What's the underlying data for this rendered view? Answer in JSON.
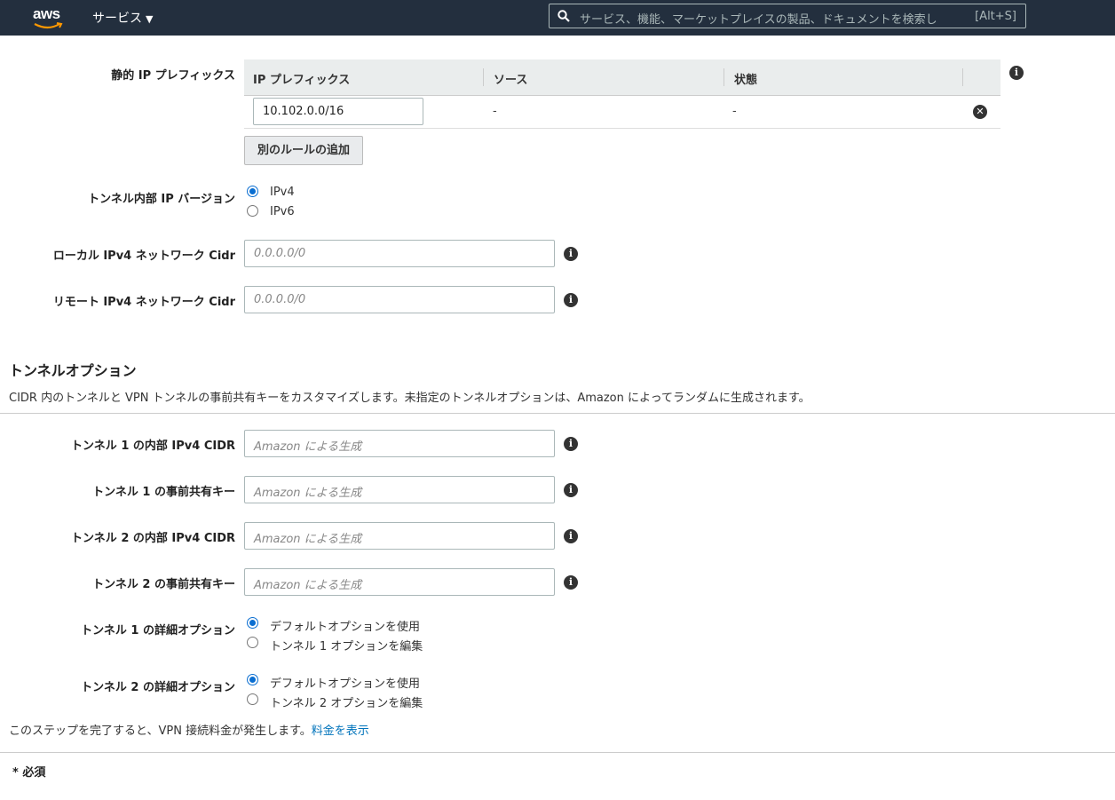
{
  "topbar": {
    "logo_text": "aws",
    "services_label": "サービス",
    "search_placeholder": "サービス、機能、マーケットプレイスの製品、ドキュメントを検索し",
    "search_shortcut": "[Alt+S]"
  },
  "static_ip": {
    "label": "静的 IP プレフィックス",
    "columns": [
      "IP プレフィックス",
      "ソース",
      "状態"
    ],
    "row": {
      "prefix": "10.102.0.0/16",
      "source": "-",
      "state": "-"
    },
    "add_rule_button": "別のルールの追加"
  },
  "tunnel_ip_version": {
    "label": "トンネル内部 IP バージョン",
    "options": [
      "IPv4",
      "IPv6"
    ],
    "selected": "IPv4"
  },
  "local_cidr": {
    "label": "ローカル IPv4 ネットワーク Cidr",
    "placeholder": "0.0.0.0/0"
  },
  "remote_cidr": {
    "label": "リモート IPv4 ネットワーク Cidr",
    "placeholder": "0.0.0.0/0"
  },
  "tunnel_options": {
    "title": "トンネルオプション",
    "description": "CIDR 内のトンネルと VPN トンネルの事前共有キーをカスタマイズします。未指定のトンネルオプションは、Amazon によってランダムに生成されます。",
    "tunnel1_cidr": {
      "label": "トンネル 1 の内部 IPv4 CIDR",
      "placeholder": "Amazon による生成"
    },
    "tunnel1_psk": {
      "label": "トンネル 1 の事前共有キー",
      "placeholder": "Amazon による生成"
    },
    "tunnel2_cidr": {
      "label": "トンネル 2 の内部 IPv4 CIDR",
      "placeholder": "Amazon による生成"
    },
    "tunnel2_psk": {
      "label": "トンネル 2 の事前共有キー",
      "placeholder": "Amazon による生成"
    },
    "tunnel1_advanced": {
      "label": "トンネル 1 の詳細オプション",
      "options": [
        "デフォルトオプションを使用",
        "トンネル 1 オプションを編集"
      ],
      "selected": "デフォルトオプションを使用"
    },
    "tunnel2_advanced": {
      "label": "トンネル 2 の詳細オプション",
      "options": [
        "デフォルトオプションを使用",
        "トンネル 2 オプションを編集"
      ],
      "selected": "デフォルトオプションを使用"
    }
  },
  "footer": {
    "charge_note": "このステップを完了すると、VPN 接続料金が発生します。",
    "pricing_link": "料金を表示",
    "required_note": "* 必須"
  },
  "colors": {
    "topbar": "#232f3e",
    "link": "#0073bb",
    "radio_selected": "#0a6ed1"
  }
}
